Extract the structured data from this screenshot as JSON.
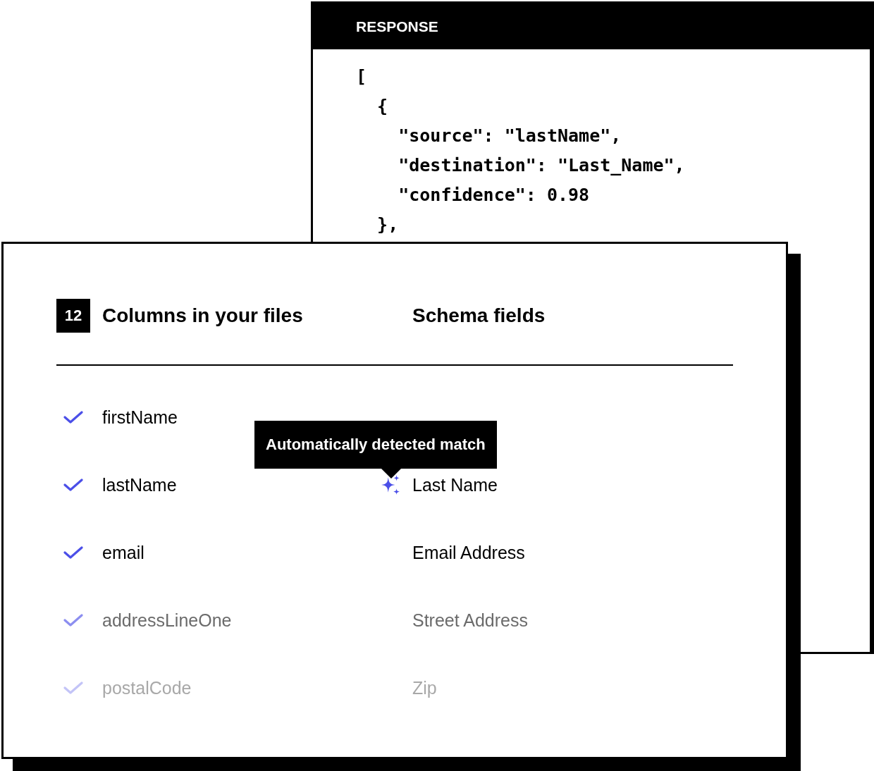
{
  "response_panel": {
    "title": "RESPONSE",
    "code_lines": [
      "[",
      "  {",
      "    \"source\": \"lastName\",",
      "    \"destination\": \"Last_Name\",",
      "    \"confidence\": 0.98",
      "  },"
    ]
  },
  "mapping_panel": {
    "count_badge": "12",
    "columns_heading": "Columns in your files",
    "schema_heading": "Schema fields",
    "rows": [
      {
        "column": "firstName",
        "checked": true,
        "kind": "normal",
        "auto_detected": false
      },
      {
        "column": "lastName",
        "field": "Last Name",
        "checked": true,
        "kind": "normal",
        "auto_detected": true,
        "tooltip": "Automatically detected match"
      },
      {
        "column": "email",
        "field": "Email Address",
        "checked": true,
        "kind": "normal",
        "auto_detected": false
      },
      {
        "column": "addressLineOne",
        "field": "Street Address",
        "checked": true,
        "kind": "dim",
        "auto_detected": false
      },
      {
        "column": "postalCode",
        "field": "Zip",
        "checked": true,
        "kind": "faint",
        "auto_detected": false
      }
    ]
  }
}
